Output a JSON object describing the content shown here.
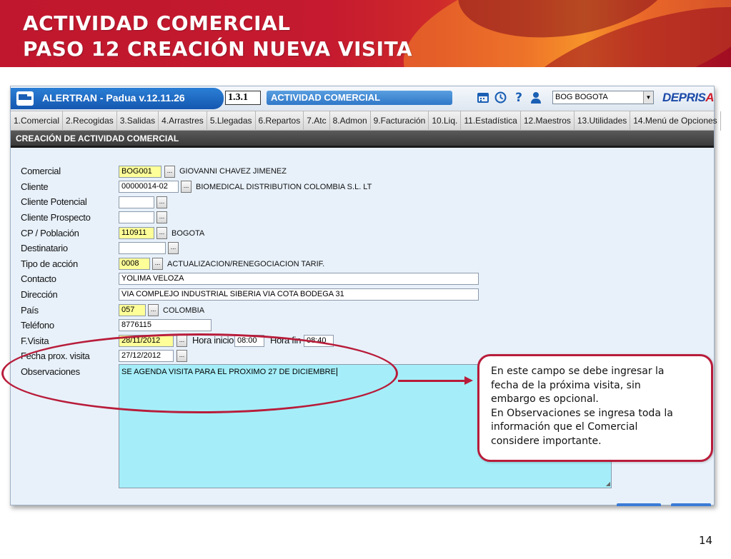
{
  "slide": {
    "title_line1": "ACTIVIDAD COMERCIAL",
    "title_line2": "PASO 12 CREACIÓN NUEVA VISITA",
    "page_number": "14",
    "accent_color": "#c0172e"
  },
  "app": {
    "title": "ALERTRAN - Padua  v.12.11.26",
    "screen_code": "1.3.1",
    "module_name": "ACTIVIDAD COMERCIAL",
    "city_select": "BOG BOGOTA",
    "brand": "DEPRIS",
    "brand_accent": "A",
    "toolbar_icons": [
      "calendar-icon",
      "clock-icon",
      "help-icon",
      "user-icon"
    ]
  },
  "menu": [
    "1.Comercial",
    "2.Recogidas",
    "3.Salidas",
    "4.Arrastres",
    "5.Llegadas",
    "6.Repartos",
    "7.Atc",
    "8.Admon",
    "9.Facturación",
    "10.Liq.",
    "11.Estadística",
    "12.Maestros",
    "13.Utilidades",
    "14.Menú de Opciones"
  ],
  "form": {
    "header": "CREACIÓN DE ACTIVIDAD COMERCIAL",
    "comercial": {
      "label": "Comercial",
      "value": "BOG001",
      "description": "GIOVANNI CHAVEZ JIMENEZ"
    },
    "cliente": {
      "label": "Cliente",
      "value": "00000014-02",
      "description": "BIOMEDICAL DISTRIBUTION COLOMBIA S.L. LT"
    },
    "cliente_potencial": {
      "label": "Cliente Potencial",
      "value": ""
    },
    "cliente_prospecto": {
      "label": "Cliente Prospecto",
      "value": ""
    },
    "cp_poblacion": {
      "label": "CP / Población",
      "value": "110911",
      "description": "BOGOTA"
    },
    "destinatario": {
      "label": "Destinatario",
      "value": ""
    },
    "tipo_accion": {
      "label": "Tipo de acción",
      "value": "0008",
      "description": "ACTUALIZACION/RENEGOCIACION TARIF."
    },
    "contacto": {
      "label": "Contacto",
      "value": "YOLIMA VELOZA"
    },
    "direccion": {
      "label": "Dirección",
      "value": "VIA COMPLEJO INDUSTRIAL SIBERIA VIA COTA BODEGA 31"
    },
    "pais": {
      "label": "País",
      "value": "057",
      "description": "COLOMBIA"
    },
    "telefono": {
      "label": "Teléfono",
      "value": "8776115"
    },
    "f_visita": {
      "label": "F.Visita",
      "value": "28/11/2012"
    },
    "hora_inicio": {
      "label": "Hora inicio",
      "value": "08:00"
    },
    "hora_fin": {
      "label": "Hora fin",
      "value": "08:40"
    },
    "fecha_prox_visita": {
      "label": "Fecha prox. visita",
      "value": "27/12/2012"
    },
    "observaciones": {
      "label": "Observaciones",
      "value": "SE AGENDA VISITA PARA EL PROXIMO 27 DE DICIEMBRE"
    },
    "lookup_button": "..."
  },
  "callout": {
    "line1": "En este campo se debe ingresar la",
    "line2": "fecha de la próxima visita, sin",
    "line3": "embargo es opcional.",
    "line4": "En Observaciones se ingresa toda la",
    "line5": "información que el Comercial",
    "line6": "considere importante.",
    "border_color": "#b81c3a"
  }
}
